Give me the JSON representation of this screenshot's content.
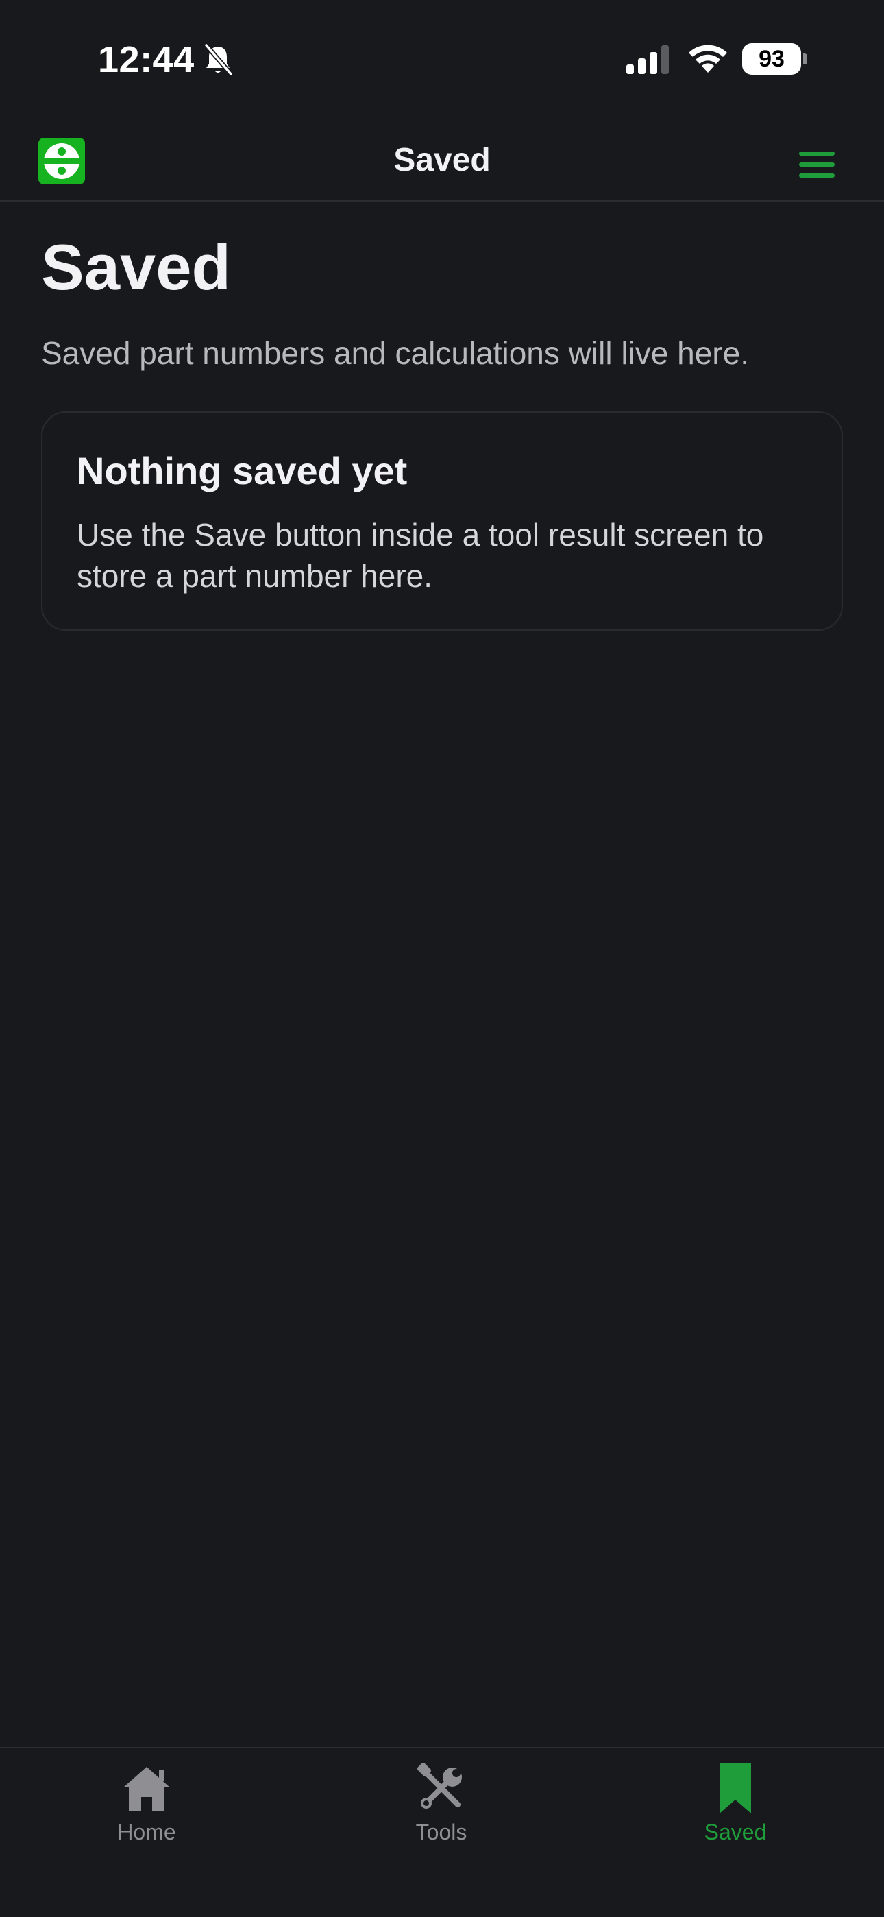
{
  "status_bar": {
    "time": "12:44",
    "battery_level": "93",
    "icons": [
      "bell-slash-icon",
      "cellular-signal-icon",
      "wifi-icon",
      "battery-icon"
    ]
  },
  "nav": {
    "title": "Saved",
    "logo_icon": "app-logo-icon",
    "menu_icon": "hamburger-menu-icon",
    "accent_color": "#1f9d3a"
  },
  "page": {
    "heading": "Saved",
    "subtitle": "Saved part numbers and calculations will live here."
  },
  "empty_state": {
    "title": "Nothing saved yet",
    "body": "Use the Save button inside a tool result screen to store a part number here."
  },
  "tab_bar": {
    "tabs": [
      {
        "label": "Home",
        "icon": "home-icon",
        "active": false
      },
      {
        "label": "Tools",
        "icon": "tools-icon",
        "active": false
      },
      {
        "label": "Saved",
        "icon": "bookmark-icon",
        "active": true
      }
    ],
    "active_color": "#1f9d3a",
    "inactive_color": "#8e8e93"
  }
}
